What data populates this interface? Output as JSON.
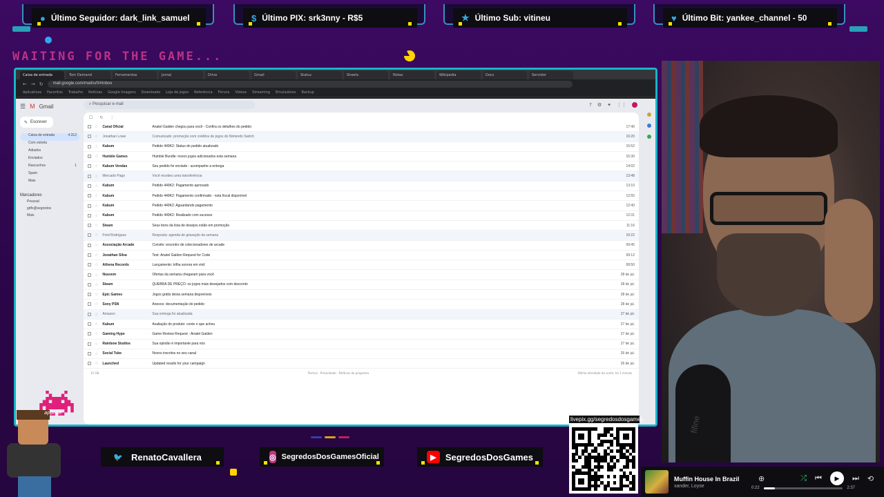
{
  "tickers": [
    {
      "icon": "user-icon",
      "label": "Último Seguidor: dark_link_samuel"
    },
    {
      "icon": "pix-icon",
      "label": "Último PIX: srk3nny - R$5"
    },
    {
      "icon": "star-icon",
      "label": "Último Sub: vitineu"
    },
    {
      "icon": "heart-icon",
      "label": "Último Bit: yankee_channel - 50"
    }
  ],
  "waiting_text": "WAITING FOR THE GAME...",
  "browser": {
    "tabs": [
      "Caixa de entrada",
      "Tom Demand",
      "Ferramentas",
      "Jornal",
      "Drive",
      "Gmail",
      "Status",
      "Sheets",
      "Notas",
      "Wikipedia",
      "Docs",
      "Servidor"
    ],
    "url": "mail.google.com/mail/u/0/#inbox",
    "bookmarks": [
      "Aplicativos",
      "Favoritos",
      "Trabalho",
      "Notícias",
      "Google Imagens",
      "Downloads",
      "Loja de jogos",
      "Referência",
      "Fóruns",
      "Vídeos",
      "Streaming",
      "Emuladores",
      "Backup"
    ]
  },
  "gmail": {
    "app_name": "Gmail",
    "search_placeholder": "Pesquisar e-mail",
    "compose_label": "Escrever",
    "nav": [
      {
        "label": "Caixa de entrada",
        "count": "4.312"
      },
      {
        "label": "Com estrela",
        "count": ""
      },
      {
        "label": "Adiados",
        "count": ""
      },
      {
        "label": "Enviados",
        "count": ""
      },
      {
        "label": "Rascunhos",
        "count": "1"
      },
      {
        "label": "Spam",
        "count": ""
      },
      {
        "label": "Mais",
        "count": ""
      }
    ],
    "labels_heading": "Marcadores",
    "labels": [
      "Pessoal",
      "gdfx@segredos",
      "Mais"
    ],
    "emails": [
      {
        "sender": "Canal Oficial",
        "subject": "Anatel Gaiden chegou para você - Confira os detalhes do pedido",
        "date": "17:40",
        "read": false
      },
      {
        "sender": "Jonathan Lowe",
        "subject": "Comunicado: promoção com créditos de jogos do Nintendo Switch",
        "date": "16:20",
        "read": true
      },
      {
        "sender": "Kabum",
        "subject": "Pedido 449K2: Status do pedido atualizado",
        "date": "15:52",
        "read": false
      },
      {
        "sender": "Humble Games",
        "subject": "Humble Bundle: novos jogos adicionados esta semana",
        "date": "15:30",
        "read": false
      },
      {
        "sender": "Kabum Vendas",
        "subject": "Seu pedido foi enviado - acompanhe a entrega",
        "date": "14:02",
        "read": false
      },
      {
        "sender": "Mercado Pago",
        "subject": "Você recebeu uma transferência",
        "date": "13:48",
        "read": true
      },
      {
        "sender": "Kabum",
        "subject": "Pedido 449K2: Pagamento aprovado",
        "date": "13:10",
        "read": false
      },
      {
        "sender": "Kabum",
        "subject": "Pedido 449K2: Pagamento confirmado - nota fiscal disponível",
        "date": "12:55",
        "read": false
      },
      {
        "sender": "Kabum",
        "subject": "Pedido 449K2: Aguardando pagamento",
        "date": "12:40",
        "read": false
      },
      {
        "sender": "Kabum",
        "subject": "Pedido 449K2: Realizado com sucesso",
        "date": "12:31",
        "read": false
      },
      {
        "sender": "Steam",
        "subject": "Seus itens da lista de desejos estão em promoção",
        "date": "11:16",
        "read": false
      },
      {
        "sender": "Fred Rodrigues",
        "subject": "Resposta: agenda de gravação da semana",
        "date": "10:22",
        "read": true
      },
      {
        "sender": "Associação Arcade",
        "subject": "Convite: encontro de colecionadores de arcade",
        "date": "09:45",
        "read": false
      },
      {
        "sender": "Jonathan Silva",
        "subject": "Test: Anatel Gaiden Request for Code",
        "date": "09:12",
        "read": false
      },
      {
        "sender": "Athena Records",
        "subject": "Lançamento: trilha sonora em vinil",
        "date": "08:50",
        "read": false
      },
      {
        "sender": "Nuuvem",
        "subject": "Ofertas da semana chegaram para você",
        "date": "28 de jul.",
        "read": false
      },
      {
        "sender": "Steam",
        "subject": "QUEBRA DE PREÇO: os jogos mais desejados com desconto",
        "date": "28 de jul.",
        "read": false
      },
      {
        "sender": "Epic Games",
        "subject": "Jogos grátis desta semana disponíveis",
        "date": "28 de jul.",
        "read": false
      },
      {
        "sender": "Sony PSN",
        "subject": "Anexos: documentação do pedido",
        "date": "28 de jul.",
        "read": false
      },
      {
        "sender": "Amazon",
        "subject": "Sua entrega foi atualizada",
        "date": "27 de jul.",
        "read": true
      },
      {
        "sender": "Kabum",
        "subject": "Avaliação do produto: conte o que achou",
        "date": "27 de jul.",
        "read": false
      },
      {
        "sender": "Gaming Hype",
        "subject": "Game Review Request - Anatel Gaiden",
        "date": "27 de jul.",
        "read": false
      },
      {
        "sender": "Rainbow Studios",
        "subject": "Sua opinião é importante para nós",
        "date": "27 de jul.",
        "read": false
      },
      {
        "sender": "Social Tube",
        "subject": "Novos inscritos no seu canal",
        "date": "26 de jul.",
        "read": false
      },
      {
        "sender": "Launched",
        "subject": "Updated results for your campaign",
        "date": "26 de jul.",
        "read": false
      }
    ],
    "footer_left": "15 GB",
    "footer_mid": "Termos · Privacidade · Políticas do programa",
    "footer_right": "Última atividade da conta: há 1 minuto"
  },
  "socials": [
    {
      "icon": "twitter-icon",
      "label": "RenatoCavallera",
      "color": "#1da1f2"
    },
    {
      "icon": "instagram-icon",
      "label": "SegredosDosGamesOficial",
      "color": "#c13584"
    },
    {
      "icon": "youtube-icon",
      "label": "SegredosDosGames",
      "color": "#ff0000"
    }
  ],
  "qr_url": "livepix.gg/segredosdosgames",
  "pixel_label": "apprise",
  "mic_brand": "fifine",
  "music": {
    "title": "Muffin House In Brazil",
    "artist": "xander, Loyse",
    "elapsed": "0:22",
    "duration": "2:37",
    "progress": 0.14
  }
}
